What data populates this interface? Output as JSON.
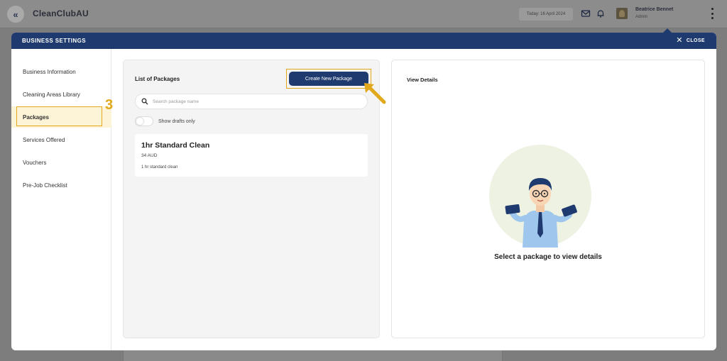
{
  "topbar": {
    "back_icon": "double-chevron-left-icon",
    "brand": "CleanClubAU",
    "date": "Today: 16 April 2024",
    "mail_icon": "mail-icon",
    "bell_icon": "bell-icon",
    "user_name": "Beatrice Bennet",
    "user_role": "Admin",
    "menu_icon": "kebab-menu-icon"
  },
  "modal": {
    "title": "BUSINESS SETTINGS",
    "close_label": "CLOSE",
    "close_icon": "close-icon"
  },
  "sidebar": {
    "items": [
      {
        "label": "Business Information"
      },
      {
        "label": "Cleaning Areas Library"
      },
      {
        "label": "Packages",
        "active": true
      },
      {
        "label": "Services Offered"
      },
      {
        "label": "Vouchers"
      },
      {
        "label": "Pre-Job Checklist"
      }
    ],
    "step_number": "3"
  },
  "packages": {
    "title": "List of Packages",
    "create_button": "Create New Package",
    "search_placeholder": "Search package name",
    "search_value": "",
    "toggle_label": "Show drafts only",
    "toggle_on": false,
    "list": [
      {
        "name": "1hr Standard Clean",
        "price": "34 AUD",
        "description": "1 hr standard clean"
      }
    ]
  },
  "details": {
    "title": "View Details",
    "empty_message": "Select a package to view details"
  },
  "colors": {
    "primary": "#1f3a6e",
    "highlight": "#e0a81a",
    "active_bg": "#fdf3d6"
  }
}
